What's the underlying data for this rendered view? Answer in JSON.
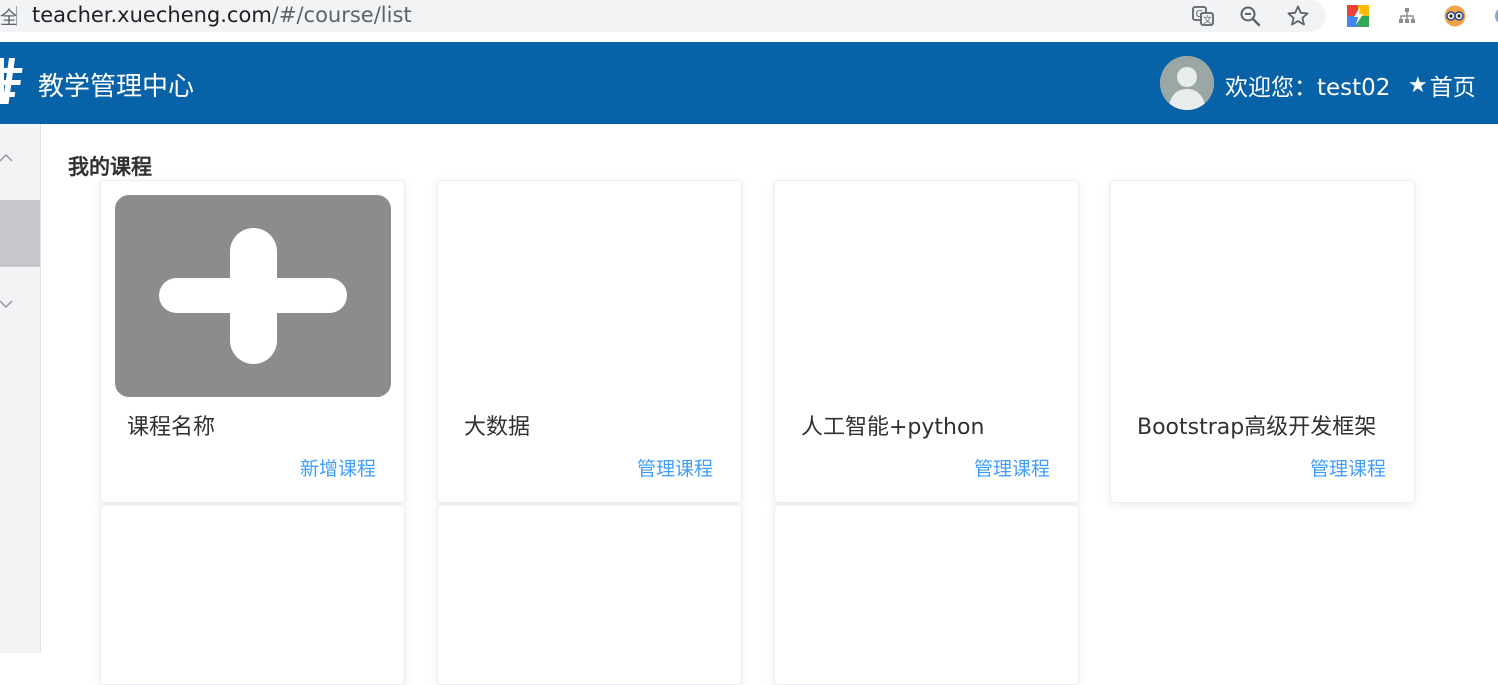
{
  "browser": {
    "lock_fragment": "全",
    "url_host": "teacher.xuecheng.com",
    "url_path": "/#/course/list"
  },
  "header": {
    "title": "教学管理中心",
    "welcome": "欢迎您：test02",
    "home_star": "★",
    "home_label": "首页",
    "bg_color": "#0862a8"
  },
  "main": {
    "section_title": "我的课程",
    "cards": [
      {
        "name": "课程名称",
        "action": "新增课程",
        "thumb_icon": "plus-icon"
      },
      {
        "name": "大数据",
        "action": "管理课程"
      },
      {
        "name": "人工智能+python",
        "action": "管理课程"
      },
      {
        "name": "Bootstrap高级开发框架",
        "action": "管理课程"
      }
    ],
    "link_color": "#409eff"
  }
}
